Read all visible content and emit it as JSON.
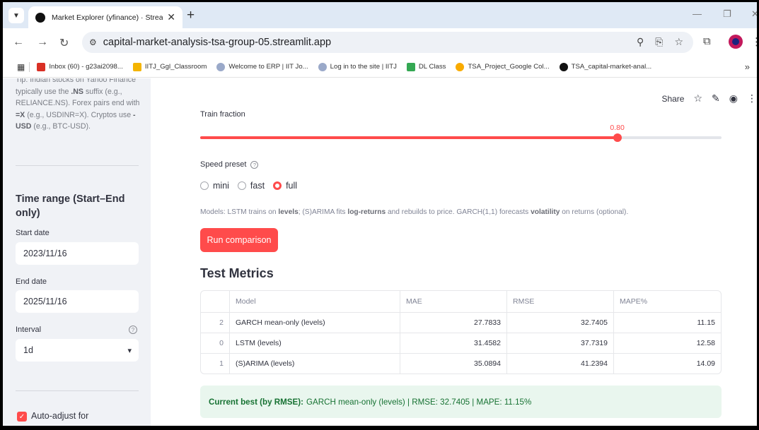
{
  "browser": {
    "tab_title": "Market Explorer (yfinance) · Streamlit",
    "url": "capital-market-analysis-tsa-group-05.streamlit.app",
    "bookmarks": [
      {
        "label": "Inbox (60) - g23ai2098...",
        "color": "#d93025"
      },
      {
        "label": "IITJ_Ggl_Classroom",
        "color": "#f4b400"
      },
      {
        "label": "Welcome to ERP | IIT Jo...",
        "color": "#9aa9c9"
      },
      {
        "label": "Log in to the site | IITJ",
        "color": "#9aa9c9"
      },
      {
        "label": "DL Class",
        "color": "#34a853"
      },
      {
        "label": "TSA_Project_Google Col...",
        "color": "#f9ab00"
      },
      {
        "label": "TSA_capital-market-anal...",
        "color": "#111111"
      }
    ],
    "bookmarks_more": "»"
  },
  "sidebar": {
    "tip_pre": "Tip: Indian stocks on Yahoo Finance typically use the ",
    "tip_ns": ".NS",
    "tip_mid": " suffix (e.g., RELIANCE.NS). Forex pairs end with ",
    "tip_x": "=X",
    "tip_mid2": " (e.g., USDINR=X). Cryptos use ",
    "tip_usd": "-USD",
    "tip_end": " (e.g., BTC-USD).",
    "time_range_heading": "Time range (Start–End only)",
    "start_label": "Start date",
    "start_value": "2023/11/16",
    "end_label": "End date",
    "end_value": "2025/11/16",
    "interval_label": "Interval",
    "interval_value": "1d",
    "auto_adjust_label": "Auto-adjust for"
  },
  "header": {
    "share_label": "Share"
  },
  "main": {
    "slider_label": "Train fraction",
    "slider_value": "0.80",
    "slider_fraction": 0.8,
    "speed_label": "Speed preset",
    "radio_options": [
      "mini",
      "fast",
      "full"
    ],
    "radio_selected": "full",
    "note_1": "Models: LSTM trains on ",
    "note_2": "levels",
    "note_3": "; (S)ARIMA fits ",
    "note_4": "log-returns",
    "note_5": " and rebuilds to price. GARCH(1,1) forecasts ",
    "note_6": "volatility",
    "note_7": " on returns (optional).",
    "run_button": "Run comparison",
    "metrics_title": "Test Metrics",
    "table": {
      "headers": [
        "",
        "Model",
        "MAE",
        "RMSE",
        "MAPE%"
      ],
      "rows": [
        {
          "idx": "2",
          "model": "GARCH mean-only (levels)",
          "mae": "27.7833",
          "rmse": "32.7405",
          "mape": "11.15"
        },
        {
          "idx": "0",
          "model": "LSTM (levels)",
          "mae": "31.4582",
          "rmse": "37.7319",
          "mape": "12.58"
        },
        {
          "idx": "1",
          "model": "(S)ARIMA (levels)",
          "mae": "35.0894",
          "rmse": "41.2394",
          "mape": "14.09"
        }
      ]
    },
    "best_label": "Current best (by RMSE):",
    "best_text": "GARCH mean-only (levels) | RMSE: 32.7405 | MAPE: 11.15%"
  },
  "colors": {
    "accent": "#ff4b4b",
    "success_bg": "#e9f6ee",
    "success_text": "#177233",
    "sidebar_bg": "#f0f2f6"
  }
}
